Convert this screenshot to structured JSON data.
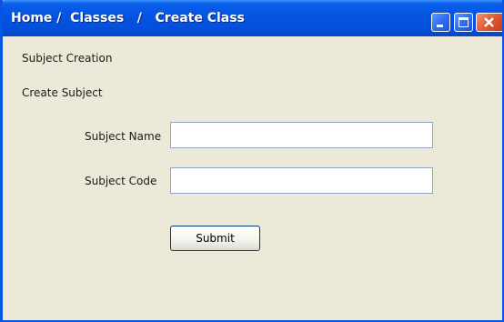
{
  "window": {
    "title": "Home /  Classes   /   Create Class",
    "controls": {
      "minimize": "minimize-icon",
      "maximize": "maximize-icon",
      "close": "close-icon"
    }
  },
  "form": {
    "section_title": "Subject Creation",
    "subheading": "Create Subject",
    "subject_name": {
      "label": "Subject Name",
      "value": "",
      "placeholder": ""
    },
    "subject_code": {
      "label": "Subject Code",
      "value": "",
      "placeholder": ""
    },
    "submit_label": "Submit"
  },
  "colors": {
    "titlebar": "#0454e2",
    "window_bg": "#ece9d8",
    "close_button": "#e0572f",
    "input_border": "#8fa5c2"
  }
}
